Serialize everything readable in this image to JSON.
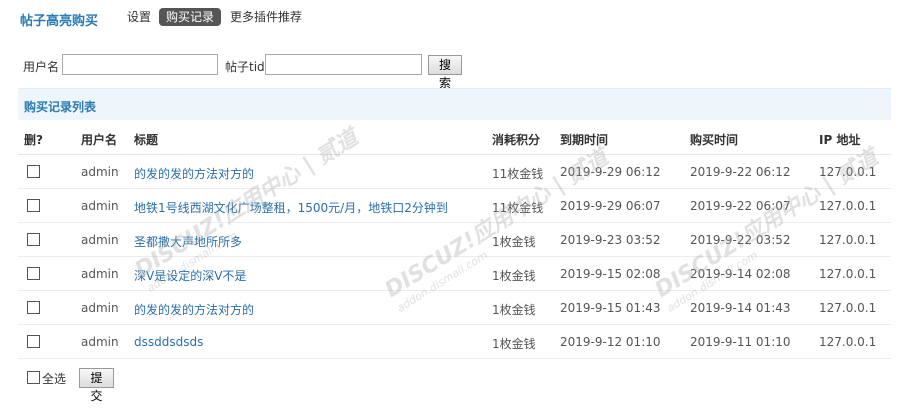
{
  "header": {
    "title": "帖子高亮购买",
    "tabs": [
      {
        "label": "设置",
        "active": false
      },
      {
        "label": "购买记录",
        "active": true
      },
      {
        "label": "更多插件推荐",
        "active": false
      }
    ]
  },
  "search": {
    "username_label": "用户名",
    "username_value": "",
    "tid_label": "帖子tid",
    "tid_value": "",
    "button_label": "搜索"
  },
  "section": {
    "title": "购买记录列表"
  },
  "table": {
    "columns": [
      "删?",
      "用户名",
      "标题",
      "消耗积分",
      "到期时间",
      "购买时间",
      "IP 地址"
    ],
    "rows": [
      {
        "username": "admin",
        "title": "的发的发的方法对方的",
        "cost": "11枚金钱",
        "expire": "2019-9-29 06:12",
        "purchased": "2019-9-22 06:12",
        "ip": "127.0.0.1"
      },
      {
        "username": "admin",
        "title": "地铁1号线西湖文化广场整租，1500元/月，地铁口2分钟到",
        "cost": "11枚金钱",
        "expire": "2019-9-29 06:07",
        "purchased": "2019-9-22 06:07",
        "ip": "127.0.0.1"
      },
      {
        "username": "admin",
        "title": "圣都撒大声地所所多",
        "cost": "1枚金钱",
        "expire": "2019-9-23 03:52",
        "purchased": "2019-9-22 03:52",
        "ip": "127.0.0.1"
      },
      {
        "username": "admin",
        "title": "深V是设定的深V不是",
        "cost": "1枚金钱",
        "expire": "2019-9-15 02:08",
        "purchased": "2019-9-14 02:08",
        "ip": "127.0.0.1"
      },
      {
        "username": "admin",
        "title": "的发的发的方法对方的",
        "cost": "1枚金钱",
        "expire": "2019-9-15 01:43",
        "purchased": "2019-9-14 01:43",
        "ip": "127.0.0.1"
      },
      {
        "username": "admin",
        "title": "dssddsdsds",
        "cost": "1枚金钱",
        "expire": "2019-9-12 01:10",
        "purchased": "2019-9-11 01:10",
        "ip": "127.0.0.1"
      }
    ]
  },
  "footer": {
    "select_all_label": "全选",
    "submit_label": "提交"
  },
  "watermark": {
    "text": "DISCUZ!应用中心 | 贰道",
    "sub": "addon.dismall.com"
  },
  "colors": {
    "accent": "#2a7ab5",
    "section_bg": "#eef6fc",
    "active_tab_bg": "#555555"
  }
}
